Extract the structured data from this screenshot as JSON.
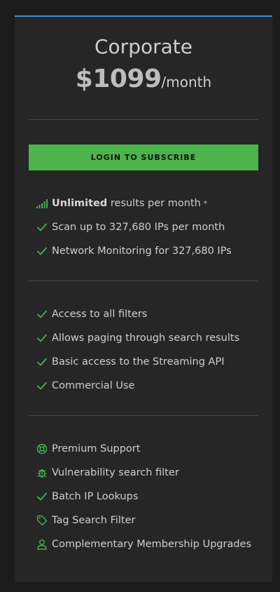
{
  "plan": {
    "name": "Corporate",
    "price": "$1099",
    "period": "/month",
    "cta_label": "LOGIN TO SUBSCRIBE"
  },
  "colors": {
    "accent_top": "#3b8fd6",
    "cta_bg": "#4bb44b",
    "check_green": "#3fb34f",
    "card_bg": "#262626"
  },
  "features_group1": [
    {
      "icon": "signal-bars-icon",
      "bold": "Unlimited",
      "text": " results per month",
      "sup": "*"
    },
    {
      "icon": "check-icon",
      "text": "Scan up to 327,680 IPs per month"
    },
    {
      "icon": "check-icon",
      "text": "Network Monitoring for 327,680 IPs"
    }
  ],
  "features_group2": [
    {
      "icon": "check-icon",
      "text": "Access to all filters"
    },
    {
      "icon": "check-icon",
      "text": "Allows paging through search results"
    },
    {
      "icon": "check-icon",
      "text": "Basic access to the Streaming API"
    },
    {
      "icon": "check-icon",
      "text": "Commercial Use"
    }
  ],
  "features_group3": [
    {
      "icon": "lifebuoy-icon",
      "text": "Premium Support"
    },
    {
      "icon": "bug-icon",
      "text": "Vulnerability search filter"
    },
    {
      "icon": "check-icon",
      "text": "Batch IP Lookups"
    },
    {
      "icon": "tag-icon",
      "text": "Tag Search Filter"
    },
    {
      "icon": "user-icon",
      "text": "Complementary Membership Upgrades"
    }
  ]
}
